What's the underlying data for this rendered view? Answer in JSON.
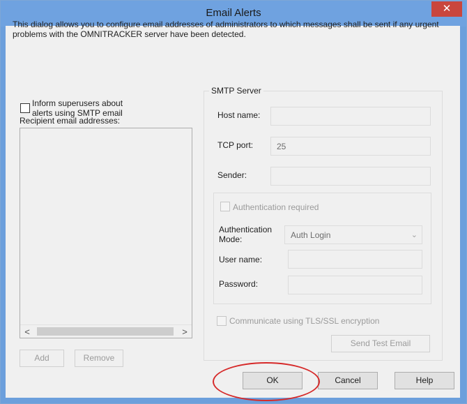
{
  "window": {
    "title": "Email Alerts",
    "close_glyph": "✕"
  },
  "description": "This dialog allows you to configure email addresses of administrators to which messages shall be sent if any urgent problems with the OMNITRACKER server have been detected.",
  "left": {
    "inform_checkbox_label_line1": "Inform superusers about",
    "inform_checkbox_label_line2": "alerts using SMTP email",
    "inform_checked": false,
    "recipients_label": "Recipient email addresses:",
    "scroll_left": "<",
    "scroll_right": ">",
    "add_label": "Add",
    "remove_label": "Remove"
  },
  "smtp": {
    "group_title": "SMTP Server",
    "host_label": "Host name:",
    "host_value": "",
    "port_label": "TCP port:",
    "port_value": "25",
    "sender_label": "Sender:",
    "sender_value": "",
    "auth_required_label": "Authentication required",
    "auth_mode_label_line1": "Authentication",
    "auth_mode_label_line2": "Mode:",
    "auth_mode_value": "Auth Login",
    "username_label": "User name:",
    "username_value": "",
    "password_label": "Password:",
    "password_value": "",
    "tls_label": "Communicate using TLS/SSL encryption",
    "send_test_label": "Send Test Email"
  },
  "footer": {
    "ok_label": "OK",
    "cancel_label": "Cancel",
    "help_label": "Help"
  },
  "colors": {
    "titlebar": "#6fa2e0",
    "close": "#c9463d",
    "highlight_circle": "#d62a2a"
  },
  "icons": {
    "close": "close-icon",
    "dropdown": "chevron-down-icon"
  }
}
